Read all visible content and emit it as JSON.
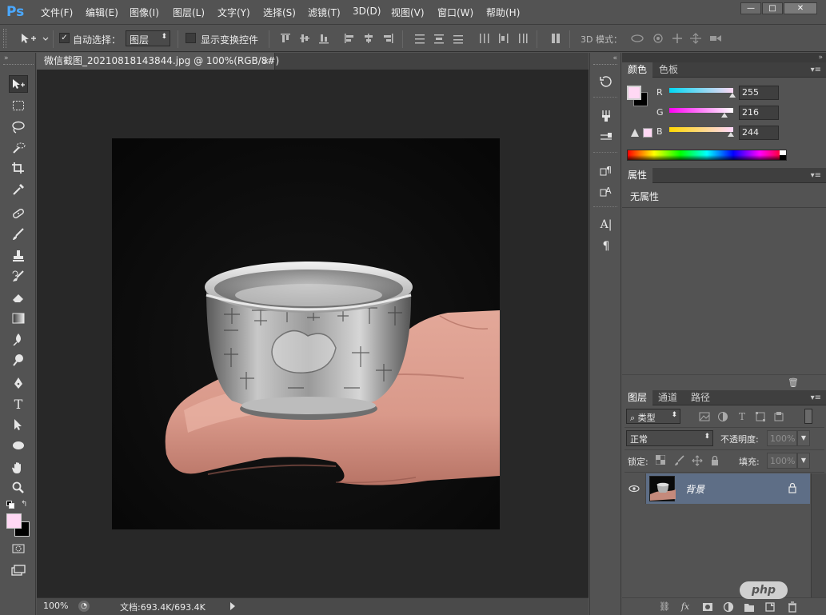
{
  "app": {
    "logo": "Ps"
  },
  "menu": [
    "文件(F)",
    "编辑(E)",
    "图像(I)",
    "图层(L)",
    "文字(Y)",
    "选择(S)",
    "滤镜(T)",
    "3D(D)",
    "视图(V)",
    "窗口(W)",
    "帮助(H)"
  ],
  "window_controls": {
    "minimize": "—",
    "restore": "□",
    "close": "✕"
  },
  "options_bar": {
    "auto_select_label": "自动选择：",
    "auto_select_checked": true,
    "auto_select_value": "图层",
    "show_transform_label": "显示变换控件",
    "show_transform_checked": false,
    "mode_3d_label": "3D 模式："
  },
  "document": {
    "tab_title": "微信截图_20210818143844.jpg @ 100%(RGB/8#)",
    "close": "×"
  },
  "status": {
    "zoom": "100%",
    "doc_info": "文档:693.4K/693.4K"
  },
  "color_panel": {
    "tabs": [
      "颜色",
      "色板"
    ],
    "active_tab": 0,
    "channels": [
      {
        "name": "R",
        "value": "255"
      },
      {
        "name": "G",
        "value": "216"
      },
      {
        "name": "B",
        "value": "244"
      }
    ],
    "foreground": "#ffd8f4",
    "background": "#000000"
  },
  "properties_panel": {
    "tabs": [
      "属性"
    ],
    "content": "无属性"
  },
  "layers_panel": {
    "tabs": [
      "图层",
      "通道",
      "路径"
    ],
    "active_tab": 0,
    "filter_label": "类型",
    "blend_mode": "正常",
    "opacity_label": "不透明度:",
    "opacity_value": "100%",
    "lock_label": "锁定:",
    "fill_label": "填充:",
    "fill_value": "100%",
    "layers": [
      {
        "name": "背景",
        "visible": true,
        "locked": true
      }
    ]
  },
  "colors": {
    "chrome": "#535353",
    "canvas_bg": "#282828",
    "accent": "#4aa8ff",
    "layer_selected": "#5e6e86"
  }
}
